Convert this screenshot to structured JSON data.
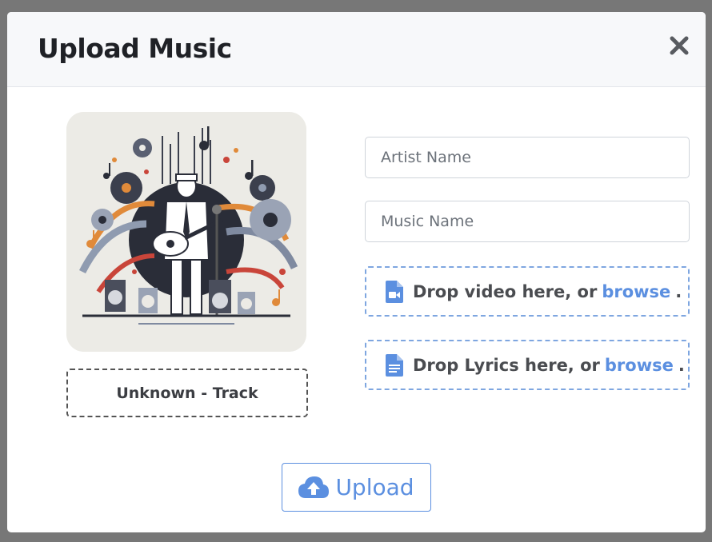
{
  "modal": {
    "title": "Upload Music",
    "close_icon": "close-icon"
  },
  "cover": {
    "alt": "illustration-of-guitarist-with-music-notes",
    "track_label": "Unknown - Track"
  },
  "form": {
    "artist_placeholder": "Artist Name",
    "artist_value": "",
    "music_placeholder": "Music Name",
    "music_value": ""
  },
  "dropzones": {
    "video": {
      "icon": "video-file-icon",
      "prefix": "Drop video here, or",
      "browse": "browse",
      "suffix": "."
    },
    "lyrics": {
      "icon": "document-file-icon",
      "prefix": "Drop Lyrics here, or",
      "browse": "browse",
      "suffix": "."
    }
  },
  "upload_button": {
    "label": "Upload",
    "icon": "cloud-upload-icon"
  },
  "colors": {
    "accent": "#5b8fe0",
    "title": "#1f2126",
    "backdrop": "#777777"
  }
}
